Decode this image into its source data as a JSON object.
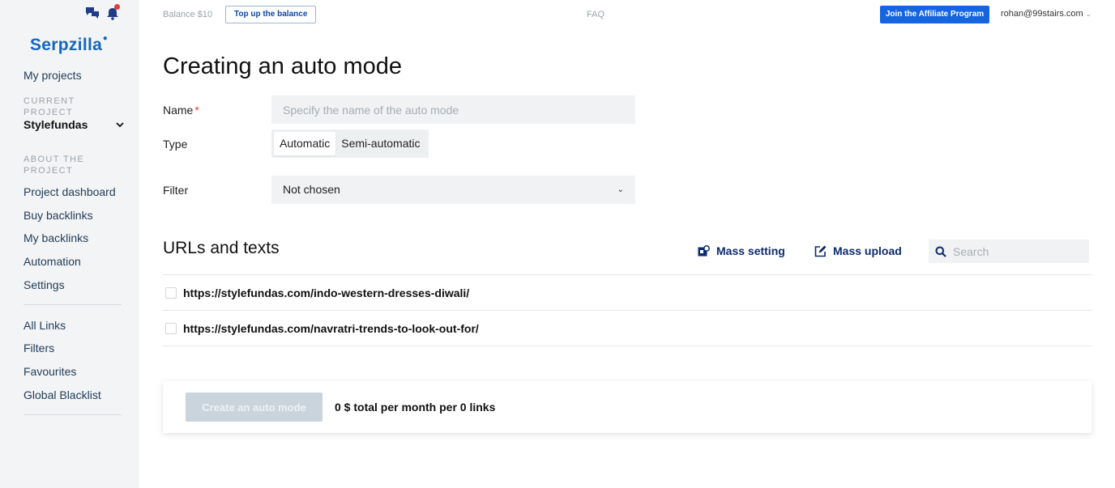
{
  "sidebar": {
    "logo": "Serpzilla",
    "my_projects": "My projects",
    "current_project_heading": "CURRENT PROJECT",
    "current_project": "Stylefundas",
    "about_heading": "ABOUT THE PROJECT",
    "about_items": [
      "Project dashboard",
      "Buy backlinks",
      "My backlinks",
      "Automation",
      "Settings"
    ],
    "bottom_items": [
      "All Links",
      "Filters",
      "Favourites",
      "Global Blacklist"
    ]
  },
  "topbar": {
    "balance": "Balance $10",
    "topup": "Top up the balance",
    "faq": "FAQ",
    "affiliate": "Join the Affiliate Program",
    "user_email": "rohan@99stairs.com"
  },
  "main": {
    "title": "Creating an auto mode",
    "name_label": "Name",
    "name_required": "*",
    "name_placeholder": "Specify the name of the auto mode",
    "type_label": "Type",
    "type_options": [
      "Automatic",
      "Semi-automatic"
    ],
    "type_selected": "Automatic",
    "filter_label": "Filter",
    "filter_value": "Not chosen"
  },
  "urls_section": {
    "title": "URLs and texts",
    "mass_setting": "Mass setting",
    "mass_upload": "Mass upload",
    "search_placeholder": "Search",
    "urls": [
      "https://stylefundas.com/indo-western-dresses-diwali/",
      "https://stylefundas.com/navratri-trends-to-look-out-for/"
    ]
  },
  "footer": {
    "create_button": "Create an auto mode",
    "total_text": "0 $ total per month per 0 links"
  },
  "colors": {
    "accent": "#1565e0",
    "sidebar_bg": "#f3f4f5",
    "notification": "#e53935"
  }
}
